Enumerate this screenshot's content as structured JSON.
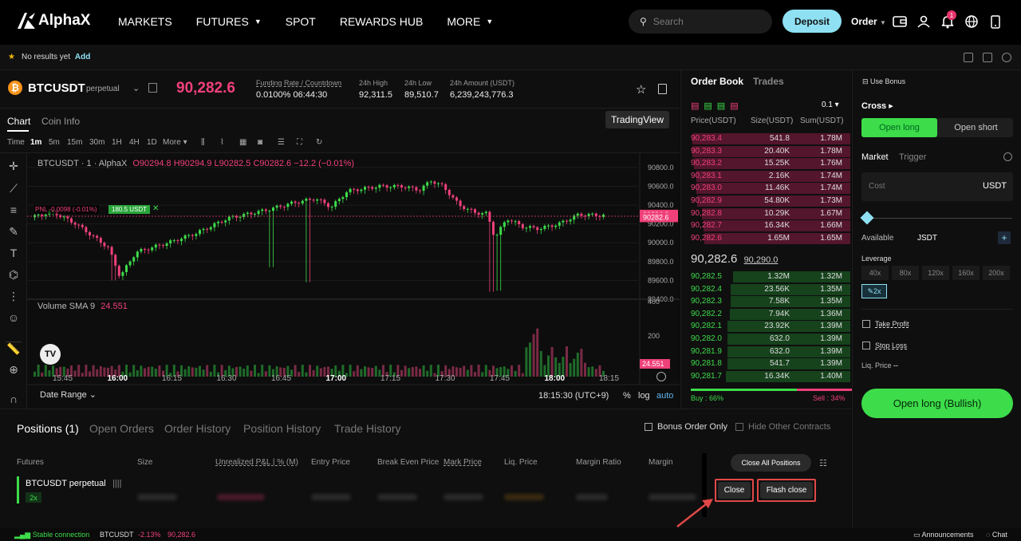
{
  "nav": {
    "brand": "AlphaX",
    "menu": [
      "MARKETS",
      "FUTURES",
      "SPOT",
      "REWARDS HUB",
      "MORE"
    ],
    "search_placeholder": "Search",
    "deposit": "Deposit",
    "order": "Order",
    "notif_count": "1"
  },
  "favbar": {
    "empty": "No results yet",
    "add": "Add"
  },
  "ticker": {
    "symbol": "BTCUSDT",
    "type": "perpetual",
    "price": "90,282.6",
    "funding_label": "Funding Rate / Countdown",
    "funding_value": "0.0100% 06:44:30",
    "high_label": "24h High",
    "high": "92,311.5",
    "low_label": "24h Low",
    "low": "89,510.7",
    "amount_label": "24h Amount (USDT)",
    "amount": "6,239,243,776.3"
  },
  "chart_tabs": {
    "chart": "Chart",
    "coin_info": "Coin Info",
    "tradingview": "TradingView"
  },
  "intervals": [
    "Time",
    "1m",
    "5m",
    "15m",
    "30m",
    "1H",
    "4H",
    "1D",
    "More"
  ],
  "chart": {
    "legend_symbol": "BTCUSDT · 1 · AlphaX",
    "o": "O90294.8",
    "h": "H90294.9",
    "l": "L90282.5",
    "c": "C90282.6",
    "chg": "−12.2 (−0.01%)",
    "pnl": "PNL -0.0098 (-0.01%)",
    "pos": "180.5 USDT",
    "vol_label": "Volume SMA 9",
    "vol_value": "24.551",
    "price_ticks": [
      "90800.0",
      "90600.0",
      "90400.0",
      "90200.0",
      "90000.0",
      "89800.0",
      "89600.0",
      "89400.0"
    ],
    "tag1": "90294.9",
    "tag2": "90282.6",
    "vol_ticks": [
      "400",
      "200"
    ],
    "vol_tag": "24.551",
    "times": [
      "15:45",
      "16:00",
      "16:15",
      "16:30",
      "16:45",
      "17:00",
      "17:15",
      "17:30",
      "17:45",
      "18:00",
      "18:15"
    ],
    "date_range": "Date Range",
    "clock": "18:15:30 (UTC+9)",
    "pct": "%",
    "log": "log",
    "auto": "auto"
  },
  "orderbook": {
    "tab1": "Order Book",
    "tab2": "Trades",
    "step": "0.1",
    "col_price": "Price(USDT)",
    "col_size": "Size(USDT)",
    "col_sum": "Sum(USDT)",
    "asks": [
      [
        "90,283.4",
        "541.8",
        "1.78M"
      ],
      [
        "90,283.3",
        "20.40K",
        "1.78M"
      ],
      [
        "90,283.2",
        "15.25K",
        "1.76M"
      ],
      [
        "90,283.1",
        "2.16K",
        "1.74M"
      ],
      [
        "90,283.0",
        "11.46K",
        "1.74M"
      ],
      [
        "90,282.9",
        "54.80K",
        "1.73M"
      ],
      [
        "90,282.8",
        "10.29K",
        "1.67M"
      ],
      [
        "90,282.7",
        "16.34K",
        "1.66M"
      ],
      [
        "90,282.6",
        "1.65M",
        "1.65M"
      ]
    ],
    "last": "90,282.6",
    "mark": "90,290.0",
    "bids": [
      [
        "90,282.5",
        "1.32M",
        "1.32M"
      ],
      [
        "90,282.4",
        "23.56K",
        "1.35M"
      ],
      [
        "90,282.3",
        "7.58K",
        "1.35M"
      ],
      [
        "90,282.2",
        "7.94K",
        "1.36M"
      ],
      [
        "90,282.1",
        "23.92K",
        "1.39M"
      ],
      [
        "90,282.0",
        "632.0",
        "1.39M"
      ],
      [
        "90,281.9",
        "632.0",
        "1.39M"
      ],
      [
        "90,281.8",
        "541.7",
        "1.39M"
      ],
      [
        "90,281.7",
        "16.34K",
        "1.40M"
      ]
    ],
    "buy": "Buy : 66%",
    "sell": "Sell : 34%"
  },
  "trade": {
    "bonus": "Use Bonus",
    "margin_mode": "Cross",
    "open_long": "Open long",
    "open_short": "Open short",
    "market": "Market",
    "trigger": "Trigger",
    "cost_placeholder": "Cost",
    "unit": "USDT",
    "available": "Available",
    "avail_unit": "JSDT",
    "leverage": "Leverage",
    "levs": [
      "40x",
      "80x",
      "120x",
      "160x",
      "200x"
    ],
    "lev_sel": "2x",
    "tp": "Take Profit",
    "sl": "Stop Loss",
    "liq": "Liq. Price",
    "liq_val": "--",
    "submit": "Open long (Bullish)"
  },
  "bottom": {
    "tabs": [
      "Positions (1)",
      "Open Orders",
      "Order History",
      "Position History",
      "Trade History"
    ],
    "bonus_only": "Bonus Order Only",
    "hide_other": "Hide Other Contracts",
    "cols": [
      "Futures",
      "Size",
      "Unrealized P&L | % (M)",
      "Entry Price",
      "Break Even Price",
      "Mark Price",
      "Liq. Price",
      "Margin Ratio",
      "Margin"
    ],
    "close_all": "Close All Positions",
    "row_symbol": "BTCUSDT perpetual",
    "row_lev": "2x",
    "close": "Close",
    "flash_close": "Flash close"
  },
  "footer": {
    "conn": "Stable connection",
    "sym": "BTCUSDT",
    "chg": "-2.13%",
    "price": "90,282.6",
    "ann": "Announcements",
    "chat": "Chat"
  },
  "colors": {
    "up": "#3ddc4a",
    "down": "#f0407a",
    "accent": "#8fe0f3",
    "brand_green": "#3ddc4a"
  }
}
